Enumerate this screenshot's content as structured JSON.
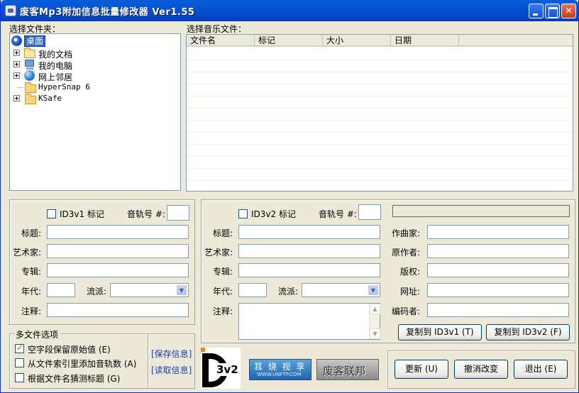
{
  "window": {
    "title": "废客Mp3附加信息批量修改器 Ver1.55"
  },
  "folder_pane": {
    "label": "选择文件夹：",
    "items": [
      {
        "label": "桌面",
        "icon": "desktop-icon"
      },
      {
        "label": "我的文档",
        "icon": "my-documents-icon"
      },
      {
        "label": "我的电脑",
        "icon": "my-computer-icon"
      },
      {
        "label": "网上邻居",
        "icon": "network-icon"
      },
      {
        "label": "HyperSnap 6",
        "icon": "folder-icon"
      },
      {
        "label": "KSafe",
        "icon": "folder-icon"
      }
    ]
  },
  "file_pane": {
    "label": "选择音乐文件：",
    "columns": [
      "文件名",
      "标记",
      "大小",
      "日期"
    ]
  },
  "id3v1": {
    "tag_label": "ID3v1 标记",
    "track_label": "音轨号 #:",
    "title_label": "标题:",
    "artist_label": "艺术家:",
    "album_label": "专辑:",
    "year_label": "年代:",
    "genre_label": "流派:",
    "comment_label": "注释:"
  },
  "id3v2": {
    "tag_label": "ID3v2 标记",
    "track_label": "音轨号 #:",
    "title_label": "标题:",
    "artist_label": "艺术家:",
    "album_label": "专辑:",
    "year_label": "年代:",
    "genre_label": "流派:",
    "comment_label": "注释:",
    "composer_label": "作曲家:",
    "orig_artist_label": "原作者:",
    "copyright_label": "版权:",
    "url_label": "网址:",
    "encoder_label": "编码者:",
    "copy_to_v1": "复制到 ID3v1 (T)",
    "copy_to_v2": "复制到 ID3v2 (F)"
  },
  "multi_options": {
    "legend": "多文件选项",
    "opt1": "空字段保留原始值 (E)",
    "opt2": "从文件索引里添加音轨数 (A)",
    "opt3": "根据文件名猜测标题 (G)",
    "save_info": "[保存信息]",
    "read_info": "[读取信息]"
  },
  "branding": {
    "logo_text": "3v2",
    "banner1_text": "耳 烧 视 享",
    "banner1_sub": "WWW.UNFTP.COM",
    "banner2_text": "废客联邦"
  },
  "buttons": {
    "update": "更新 (U)",
    "undo": "撤消改变",
    "exit": "退出 (E)"
  }
}
